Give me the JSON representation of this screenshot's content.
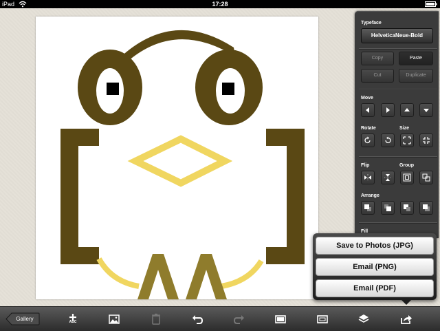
{
  "status_bar": {
    "device": "iPad",
    "time": "17:28"
  },
  "inspector": {
    "typeface_label": "Typeface",
    "typeface_value": "HelveticaNeue-Bold",
    "edit_buttons": {
      "copy": "Copy",
      "paste": "Paste",
      "cut": "Cut",
      "duplicate": "Duplicate"
    },
    "move_label": "Move",
    "rotate_label": "Rotate",
    "size_label": "Size",
    "flip_label": "Flip",
    "group_label": "Group",
    "arrange_label": "Arrange",
    "fill_label": "Fill"
  },
  "share_menu": {
    "items": [
      {
        "label": "Save to Photos (JPG)"
      },
      {
        "label": "Email (PNG)"
      },
      {
        "label": "Email (PDF)"
      }
    ]
  },
  "toolbar": {
    "gallery_label": "Gallery",
    "add_text_sublabel": "ABC",
    "icons": [
      "add-text-icon",
      "image-icon",
      "trash-icon",
      "undo-icon",
      "redo-icon",
      "fullscreen-icon",
      "fit-icon",
      "layers-icon",
      "share-icon"
    ]
  },
  "colors": {
    "glyph_brown": "#5a4814",
    "glyph_yellow": "#f0d660",
    "glyph_olive": "#8f7c2c",
    "panel_bg": "#3b3b3b"
  }
}
